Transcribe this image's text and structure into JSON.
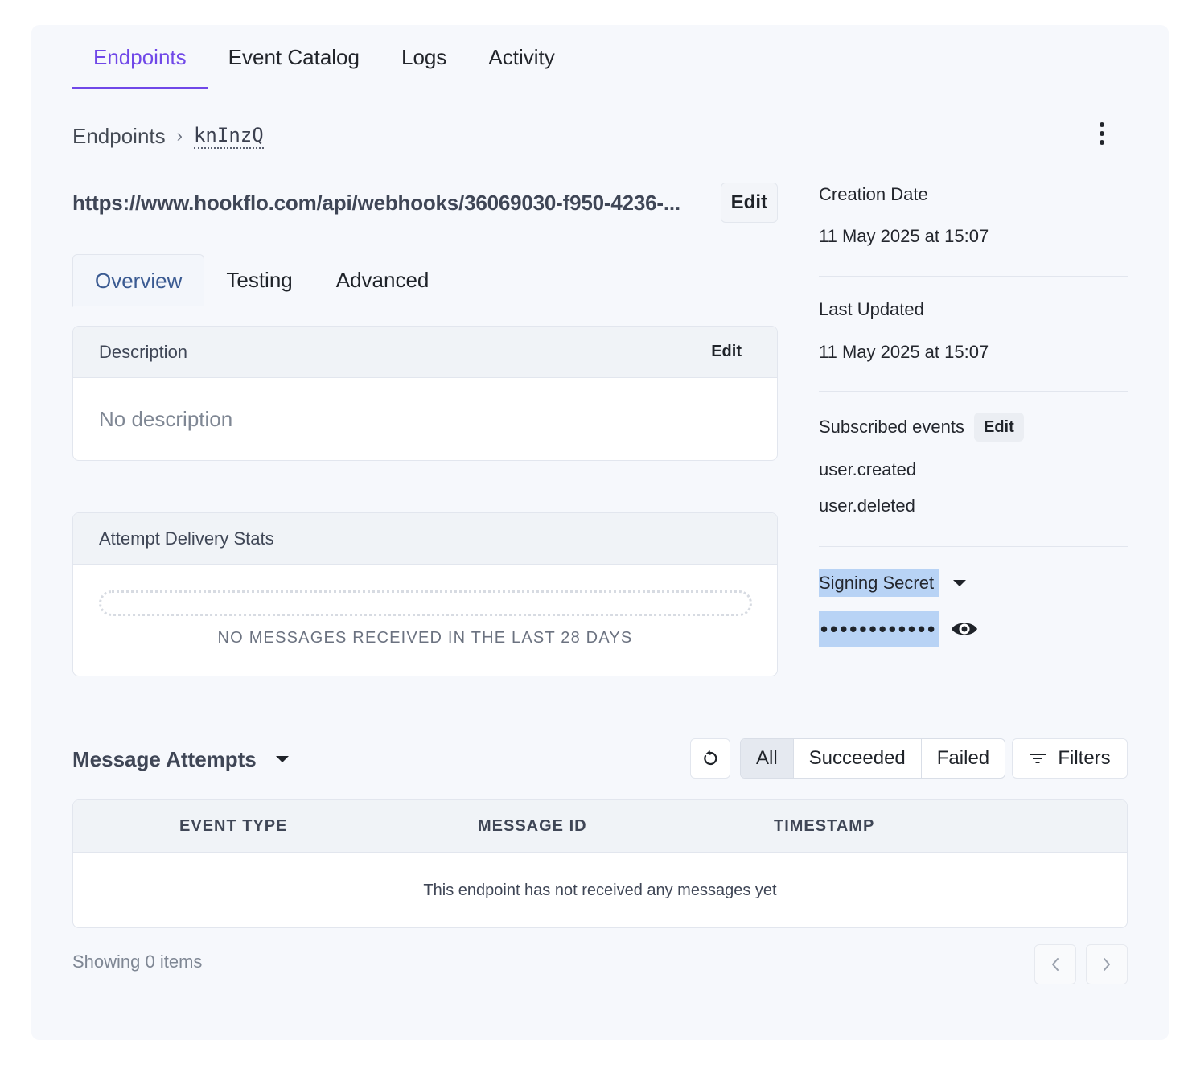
{
  "top_tabs": [
    {
      "label": "Endpoints",
      "active": true
    },
    {
      "label": "Event Catalog",
      "active": false
    },
    {
      "label": "Logs",
      "active": false
    },
    {
      "label": "Activity",
      "active": false
    }
  ],
  "breadcrumb": {
    "parent": "Endpoints",
    "separator": "›",
    "current": "knInzQ"
  },
  "endpoint": {
    "url": "https://www.hookflo.com/api/webhooks/36069030-f950-4236-...",
    "edit_label": "Edit"
  },
  "sub_tabs": [
    {
      "label": "Overview",
      "active": true
    },
    {
      "label": "Testing",
      "active": false
    },
    {
      "label": "Advanced",
      "active": false
    }
  ],
  "description_card": {
    "title": "Description",
    "edit_label": "Edit",
    "body": "No description"
  },
  "stats_card": {
    "title": "Attempt Delivery Stats",
    "empty_message": "NO MESSAGES RECEIVED IN THE LAST 28 DAYS"
  },
  "meta": {
    "creation_label": "Creation Date",
    "creation_value": "11 May 2025 at 15:07",
    "updated_label": "Last Updated",
    "updated_value": "11 May 2025 at 15:07",
    "subscribed_label": "Subscribed events",
    "subscribed_edit": "Edit",
    "events": [
      "user.created",
      "user.deleted"
    ],
    "signing_label": "Signing Secret",
    "secret_masked": "••••••••••••"
  },
  "attempts": {
    "title": "Message Attempts",
    "filters": [
      {
        "label": "All",
        "active": true
      },
      {
        "label": "Succeeded",
        "active": false
      },
      {
        "label": "Failed",
        "active": false
      }
    ],
    "filters_button": "Filters",
    "columns": [
      "EVENT TYPE",
      "MESSAGE ID",
      "TIMESTAMP"
    ],
    "empty_message": "This endpoint has not received any messages yet",
    "showing": "Showing 0 items"
  },
  "colors": {
    "accent": "#7048e8",
    "selection": "#b8d3f5",
    "panel_bg": "#f6f8fc"
  },
  "icons": [
    "kebab-menu-icon",
    "caret-down-icon",
    "eye-icon",
    "refresh-icon",
    "filter-icon",
    "chevron-left-icon",
    "chevron-right-icon"
  ]
}
